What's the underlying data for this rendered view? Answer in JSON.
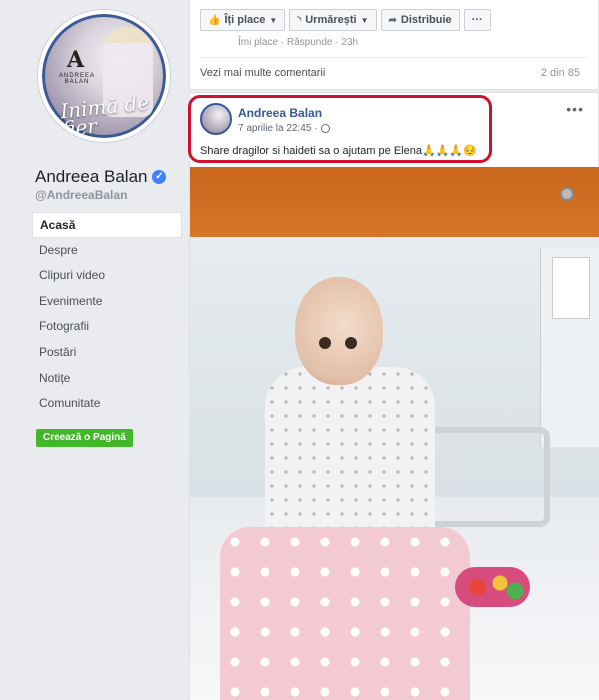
{
  "page": {
    "name": "Andreea Balan",
    "handle": "@AndreeaBalan",
    "avatar_brand": "ANDREEA BALAN",
    "avatar_logo": "A",
    "avatar_title": "Inimă de fier"
  },
  "nav": {
    "items": [
      "Acasă",
      "Despre",
      "Clipuri video",
      "Evenimente",
      "Fotografii",
      "Postări",
      "Notițe",
      "Comunitate"
    ],
    "active_index": 0,
    "create_page": "Creează o Pagină"
  },
  "top_card": {
    "actions": {
      "like": "Îți place",
      "follow": "Urmărești",
      "share": "Distribuie",
      "more": "···"
    },
    "comment_meta": "Îmi place · Răspunde · 23h",
    "more_comments": "Vezi mai multe comentarii",
    "count": "2 din 85"
  },
  "post": {
    "author": "Andreea Balan",
    "time": "7 aprilie la 22:45 ·",
    "more": "•••",
    "text": "Share dragilor si haideti sa o ajutam pe Elena🙏🙏🙏😔"
  },
  "colors": {
    "link_blue": "#365899",
    "green": "#42b72a",
    "highlight_red": "#d0102c",
    "verified_blue": "#4080ff"
  }
}
